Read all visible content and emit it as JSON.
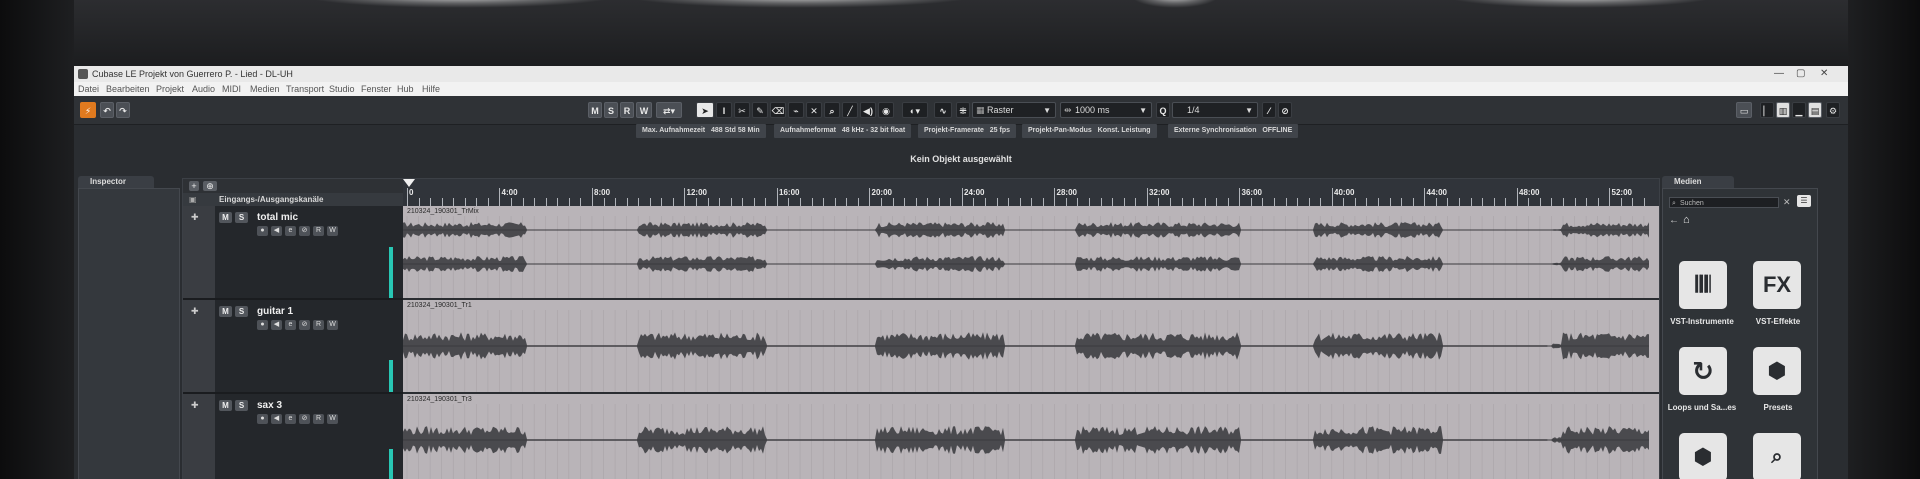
{
  "window": {
    "title": "Cubase LE Projekt von Guerrero P. - Lied - DL-UH",
    "controls": [
      "—",
      "▢",
      "✕"
    ]
  },
  "menu": [
    "Datei",
    "Bearbeiten",
    "Projekt",
    "Audio",
    "MIDI",
    "Medien",
    "Transport",
    "Studio",
    "Fenster",
    "Hub",
    "Hilfe"
  ],
  "toolbar": {
    "mode_buttons": [
      "M",
      "S",
      "R",
      "W"
    ],
    "snap_label": "Raster",
    "time_value": "1000 ms",
    "quantize_value": "1/4"
  },
  "status": [
    {
      "label": "Max. Aufnahmezeit",
      "value": "488 Std 58 Min"
    },
    {
      "label": "Aufnahmeformat",
      "value": "48 kHz - 32 bit float"
    },
    {
      "label": "Projekt-Framerate",
      "value": "25 fps"
    },
    {
      "label": "Projekt-Pan-Modus",
      "value": "Konst. Leistung"
    },
    {
      "label": "Externe Synchronisation",
      "value": "OFFLINE"
    }
  ],
  "info_line": "Kein Objekt ausgewählt",
  "inspector": {
    "tab_label": "Inspector"
  },
  "project": {
    "column_header": "Eingangs-/Ausgangskanäle",
    "ruler_labels": [
      "0",
      "4:00",
      "8:00",
      "12:00",
      "16:00",
      "20:00",
      "24:00",
      "28:00",
      "32:00",
      "36:00",
      "40:00",
      "44:00",
      "48:00",
      "52:00"
    ],
    "tracks": [
      {
        "name": "total mic",
        "event": "210324_190301_TrMix",
        "m": "M",
        "s": "S",
        "r": "R",
        "w": "W",
        "meter": 0.55
      },
      {
        "name": "guitar 1",
        "event": "210324_190301_Tr1",
        "m": "M",
        "s": "S",
        "r": "R",
        "w": "W",
        "meter": 0.35
      },
      {
        "name": "sax 3",
        "event": "210324_190301_Tr3",
        "m": "M",
        "s": "S",
        "r": "R",
        "w": "W",
        "meter": 0.4
      }
    ]
  },
  "media": {
    "tab_label": "Medien",
    "search_placeholder": "Suchen",
    "tiles": [
      {
        "label": "VST-Instrumente",
        "icon": "piano-keys-icon"
      },
      {
        "label": "VST-Effekte",
        "icon": "fx-icon",
        "glyph": "FX"
      },
      {
        "label": "Loops und Sa...es",
        "icon": "loop-icon"
      },
      {
        "label": "Presets",
        "icon": "presets-hexagon-icon"
      },
      {
        "label": "",
        "icon": "user-hexagon-icon"
      },
      {
        "label": "",
        "icon": "browse-icon"
      }
    ]
  },
  "colors": {
    "accent_orange": "#e07a1f",
    "meter_teal": "#28c7b4",
    "waveform": "#4a4a4e",
    "event_bg": "#b9b4b8"
  }
}
